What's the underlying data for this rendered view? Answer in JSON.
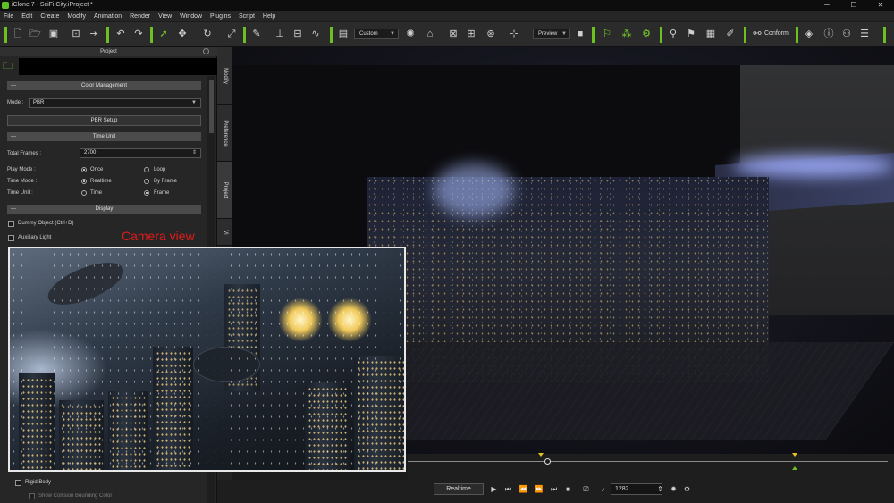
{
  "window": {
    "title": "iClone 7 - SciFi City.iProject *"
  },
  "menu": [
    "File",
    "Edit",
    "Create",
    "Modify",
    "Animation",
    "Render",
    "View",
    "Window",
    "Plugins",
    "Script",
    "Help"
  ],
  "toolbar": {
    "camera_select": "Custom",
    "preview_select": "Preview",
    "conform_label": "Conform"
  },
  "panel": {
    "title": "Project",
    "color_management": {
      "header": "Color Management",
      "mode_label": "Mode :",
      "mode_value": "PBR",
      "pbr_setup": "PBR Setup"
    },
    "time_unit": {
      "header": "Time Unit",
      "total_frames_label": "Total Frames :",
      "total_frames_value": "2700",
      "play_mode_label": "Play Mode :",
      "play_mode_options": [
        "Once",
        "Loop"
      ],
      "play_mode_selected": "Once",
      "time_mode_label": "Time Mode :",
      "time_mode_options": [
        "Realtime",
        "By Frame"
      ],
      "time_mode_selected": "Realtime",
      "time_unit_label": "Time Unit :",
      "time_unit_options": [
        "Time",
        "Frame"
      ],
      "time_unit_selected": "Frame"
    },
    "display": {
      "header": "Display",
      "dummy_object": "Dummy Object (Ctrl+D)",
      "auxiliary_light": "Auxiliary Light"
    },
    "rigid_body": "Rigid Body",
    "show_collision": "Show Collision Bounding Color"
  },
  "side_tabs": [
    "Modify",
    "Preference",
    "Project",
    "Vi"
  ],
  "overlay": {
    "camera_label": "Camera view"
  },
  "playback": {
    "mode": "Realtime",
    "frame": "1282"
  },
  "colors": {
    "accent": "#6cc01f",
    "marker": "#e6c21f",
    "camera_label": "#e21b1b"
  }
}
